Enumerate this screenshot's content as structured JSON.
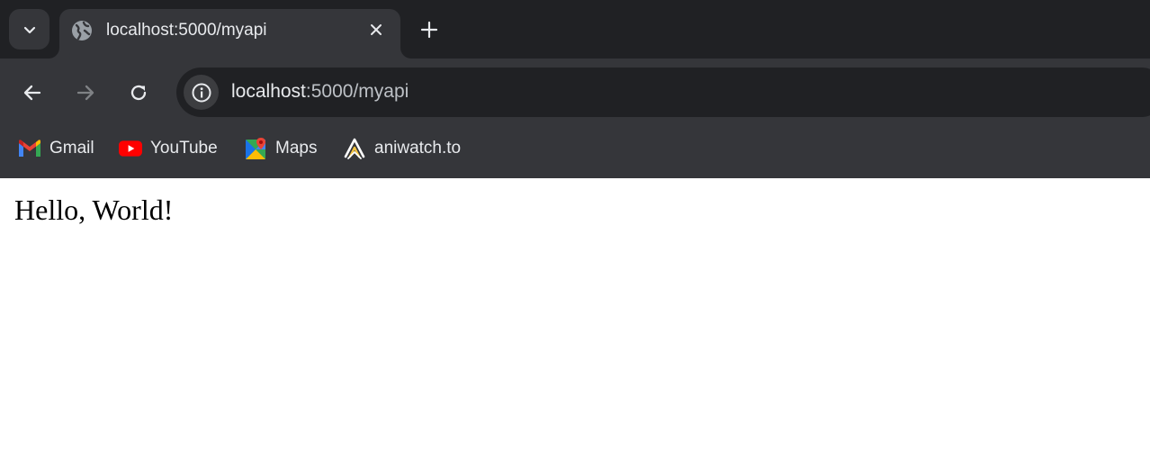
{
  "browser": {
    "tab": {
      "title": "localhost:5000/myapi",
      "favicon": "globe-icon"
    },
    "tab_search_icon": "chevron-down-icon",
    "new_tab_icon": "plus-icon",
    "toolbar": {
      "back_icon": "arrow-left-icon",
      "forward_icon": "arrow-right-icon",
      "reload_icon": "reload-icon",
      "site_info_icon": "info-icon",
      "url_host": "localhost",
      "url_rest": ":5000/myapi"
    },
    "bookmarks": [
      {
        "label": "Gmail",
        "icon": "gmail-icon"
      },
      {
        "label": "YouTube",
        "icon": "youtube-icon"
      },
      {
        "label": "Maps",
        "icon": "maps-icon"
      },
      {
        "label": "aniwatch.to",
        "icon": "aniwatch-icon"
      }
    ]
  },
  "page": {
    "text": "Hello, World!"
  },
  "colors": {
    "tabstrip": "#202124",
    "toolbar": "#35363a",
    "omnibox": "#202124",
    "text_light": "#e8eaed",
    "youtube_red": "#ff0000"
  }
}
